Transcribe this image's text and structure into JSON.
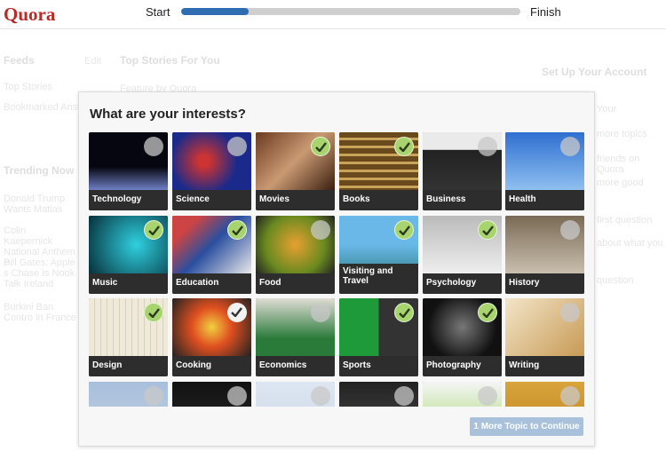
{
  "header": {
    "logo": "Quora",
    "progress_start": "Start",
    "progress_finish": "Finish",
    "progress_percent": 20,
    "progress_color": "#2f6db3"
  },
  "background": {
    "left": {
      "feeds_title": "Feeds",
      "edit": "Edit",
      "items": [
        "Top Stories",
        "Bookmarked Answers"
      ],
      "trending_title": "Trending Now",
      "trending": [
        "Donald Trump Wants Matias",
        "Colin Kaepernick National Anthem P",
        "Bill Gates: Apple s Chase is Nook Talk Ireland",
        "Burkini Ban Contro in France"
      ]
    },
    "center": {
      "title": "Top Stories For You",
      "subtitle": "Feature by Quora"
    },
    "right": {
      "title": "Set Up Your Account",
      "items": [
        "Your",
        "more topics",
        "friends on Quora",
        "more good",
        "first question",
        "about what you",
        "question"
      ]
    }
  },
  "modal": {
    "title": "What are your interests?",
    "continue_button": "1 More Topic to Continue",
    "topics": [
      {
        "label": "Technology",
        "state": "unchecked"
      },
      {
        "label": "Science",
        "state": "unchecked"
      },
      {
        "label": "Movies",
        "state": "checked"
      },
      {
        "label": "Books",
        "state": "checked"
      },
      {
        "label": "Business",
        "state": "unchecked"
      },
      {
        "label": "Health",
        "state": "unchecked"
      },
      {
        "label": "Music",
        "state": "checked"
      },
      {
        "label": "Education",
        "state": "checked"
      },
      {
        "label": "Food",
        "state": "unchecked"
      },
      {
        "label": "Visiting and Travel",
        "state": "checked"
      },
      {
        "label": "Psychology",
        "state": "checked"
      },
      {
        "label": "History",
        "state": "unchecked"
      },
      {
        "label": "Design",
        "state": "checked"
      },
      {
        "label": "Cooking",
        "state": "hover"
      },
      {
        "label": "Economics",
        "state": "unchecked"
      },
      {
        "label": "Sports",
        "state": "checked"
      },
      {
        "label": "Photography",
        "state": "checked"
      },
      {
        "label": "Writing",
        "state": "unchecked"
      },
      {
        "label": "",
        "state": "unchecked"
      },
      {
        "label": "",
        "state": "unchecked"
      },
      {
        "label": "",
        "state": "unchecked"
      },
      {
        "label": "",
        "state": "unchecked"
      },
      {
        "label": "",
        "state": "unchecked"
      },
      {
        "label": "",
        "state": "unchecked"
      }
    ]
  }
}
